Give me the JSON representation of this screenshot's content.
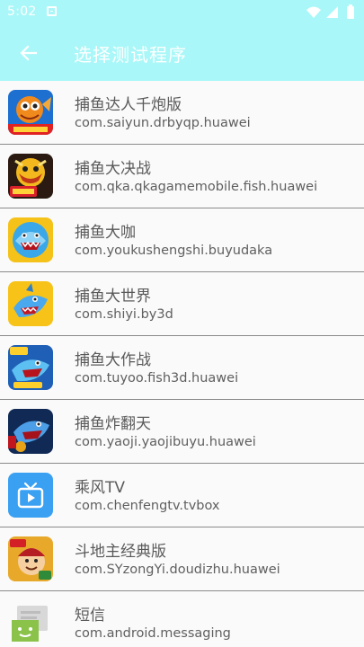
{
  "status_bar": {
    "time": "5:02"
  },
  "toolbar": {
    "title": "选择测试程序"
  },
  "colors": {
    "header_bg": "#a9f7f8",
    "divider": "#8a8a8a",
    "text": "#5a5a5a"
  },
  "apps": [
    {
      "name": "捕鱼达人千炮版",
      "package": "com.saiyun.drbyqp.huawei",
      "icon": "fish-game-icon"
    },
    {
      "name": "捕鱼大决战",
      "package": "com.qka.qkagamemobile.fish.huawei",
      "icon": "fish-game-icon"
    },
    {
      "name": "捕鱼大咖",
      "package": "com.youkushengshi.buyudaka",
      "icon": "shark-game-icon"
    },
    {
      "name": "捕鱼大世界",
      "package": "com.shiyi.by3d",
      "icon": "shark-game-icon"
    },
    {
      "name": "捕鱼大作战",
      "package": "com.tuyoo.fish3d.huawei",
      "icon": "shark-game-icon"
    },
    {
      "name": "捕鱼炸翻天",
      "package": "com.yaoji.yaojibuyu.huawei",
      "icon": "shark-game-icon"
    },
    {
      "name": "乘风TV",
      "package": "com.chenfengtv.tvbox",
      "icon": "tv-icon"
    },
    {
      "name": "斗地主经典版",
      "package": "com.SYzongYi.doudizhu.huawei",
      "icon": "card-game-icon"
    },
    {
      "name": "短信",
      "package": "com.android.messaging",
      "icon": "messaging-icon"
    }
  ]
}
